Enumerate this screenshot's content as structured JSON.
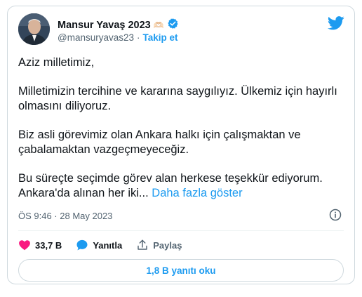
{
  "author": {
    "display_name": "Mansur Yavaş 2023",
    "emoji": "🫶🏻",
    "handle": "@mansuryavas23",
    "separator": "·",
    "follow_label": "Takip et"
  },
  "tweet": {
    "paragraphs": [
      "Aziz milletimiz,",
      "Milletimizin tercihine ve kararına saygılıyız. Ülkemiz için hayırlı olmasını diliyoruz.",
      "Biz asli görevimiz olan Ankara halkı için çalışmaktan ve çabalamaktan vazgeçmeyeceğiz.",
      "Bu süreçte seçimde görev alan herkese teşekkür ediyorum. Ankara'da alınan her iki..."
    ],
    "show_more": "Daha fazla göster",
    "timestamp": "ÖS 9:46 · 28 May 2023"
  },
  "actions": {
    "likes": "33,7 B",
    "reply_label": "Yanıtla",
    "share_label": "Paylaş"
  },
  "read_replies_label": "1,8 B yanıtı oku",
  "colors": {
    "accent": "#1d9bf0",
    "like": "#f91880",
    "muted": "#536471",
    "border": "#cfd9de"
  }
}
